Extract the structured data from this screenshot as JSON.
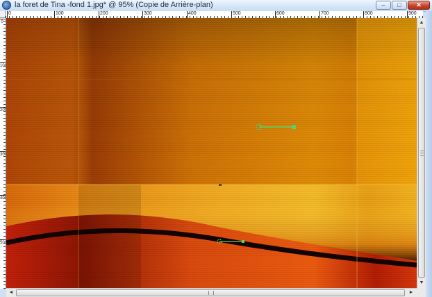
{
  "window": {
    "title": "la foret de Tina -fond 1.jpg* @  95% (Copie de Arrière-plan)",
    "icon": "paint-shop-pro-icon",
    "buttons": {
      "minimize": "–",
      "maximize": "□",
      "close": "✕"
    }
  },
  "ruler_top": {
    "labels": [
      "0",
      "100",
      "200",
      "300",
      "400",
      "500",
      "600",
      "700",
      "800",
      "900"
    ]
  },
  "ruler_left": {
    "labels": [
      "0",
      "100",
      "200",
      "300",
      "400",
      "500"
    ]
  },
  "canvas": {
    "colors": {
      "dark_red": "#9c1f05",
      "orange": "#d37a07",
      "yellow": "#f2b623",
      "black": "#120500",
      "handle_green": "#52d46a"
    }
  },
  "scrollbars": {
    "up_arrow": "▲",
    "down_arrow": "▼",
    "left_arrow": "◄",
    "right_arrow": "►"
  }
}
